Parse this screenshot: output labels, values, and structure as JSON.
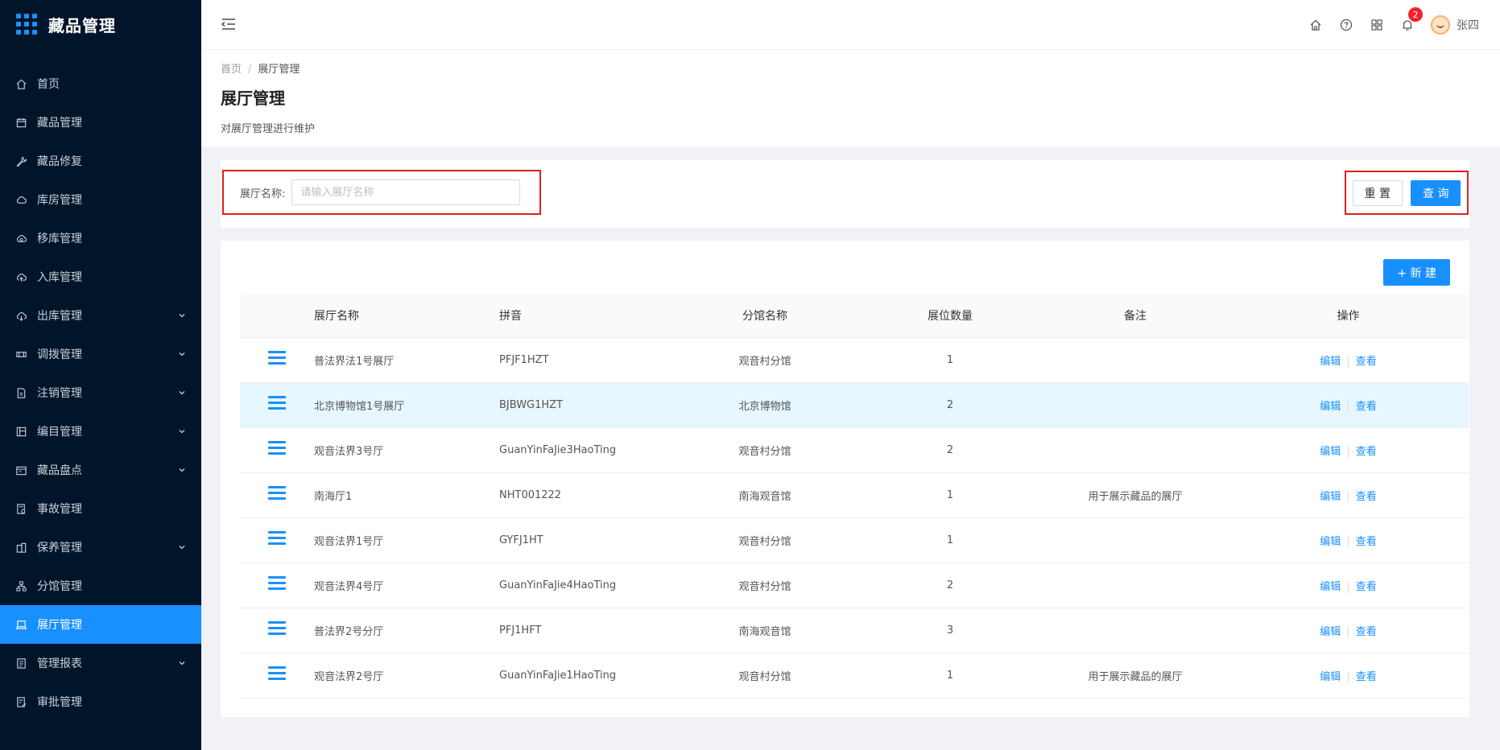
{
  "app": {
    "title": "藏品管理"
  },
  "sidebar": {
    "items": [
      {
        "label": "首页",
        "icon": "home-icon",
        "expandable": false,
        "active": false
      },
      {
        "label": "藏品管理",
        "icon": "calendar-icon",
        "expandable": false,
        "active": false
      },
      {
        "label": "藏品修复",
        "icon": "wrench-icon",
        "expandable": false,
        "active": false
      },
      {
        "label": "库房管理",
        "icon": "cloud-icon",
        "expandable": false,
        "active": false
      },
      {
        "label": "移库管理",
        "icon": "cloud-sync-icon",
        "expandable": false,
        "active": false
      },
      {
        "label": "入库管理",
        "icon": "cloud-upload-icon",
        "expandable": false,
        "active": false
      },
      {
        "label": "出库管理",
        "icon": "cloud-download-icon",
        "expandable": true,
        "active": false
      },
      {
        "label": "调拨管理",
        "icon": "transfer-icon",
        "expandable": true,
        "active": false
      },
      {
        "label": "注销管理",
        "icon": "file-icon",
        "expandable": true,
        "active": false
      },
      {
        "label": "编目管理",
        "icon": "catalog-icon",
        "expandable": true,
        "active": false
      },
      {
        "label": "藏品盘点",
        "icon": "inventory-icon",
        "expandable": true,
        "active": false
      },
      {
        "label": "事故管理",
        "icon": "report-icon",
        "expandable": false,
        "active": false
      },
      {
        "label": "保养管理",
        "icon": "building-icon",
        "expandable": true,
        "active": false
      },
      {
        "label": "分馆管理",
        "icon": "cluster-icon",
        "expandable": false,
        "active": false
      },
      {
        "label": "展厅管理",
        "icon": "laptop-icon",
        "expandable": false,
        "active": true
      },
      {
        "label": "管理报表",
        "icon": "chart-report-icon",
        "expandable": true,
        "active": false
      },
      {
        "label": "审批管理",
        "icon": "audit-icon",
        "expandable": false,
        "active": false
      }
    ]
  },
  "header": {
    "notification_count": "2",
    "user_name": "张四"
  },
  "breadcrumb": {
    "home": "首页",
    "separator": "/",
    "current": "展厅管理"
  },
  "page": {
    "title": "展厅管理",
    "description": "对展厅管理进行维护"
  },
  "search": {
    "label": "展厅名称:",
    "placeholder": "请输入展厅名称",
    "value": "",
    "reset_label": "重 置",
    "query_label": "查 询"
  },
  "table": {
    "new_label": "+ 新 建",
    "columns": [
      "展厅名称",
      "拼音",
      "分馆名称",
      "展位数量",
      "备注",
      "操作"
    ],
    "edit_label": "编辑",
    "view_label": "查看",
    "rows": [
      {
        "name": "普法界法1号展厅",
        "pinyin": "PFJF1HZT",
        "branch": "观音村分馆",
        "count": "1",
        "remark": ""
      },
      {
        "name": "北京博物馆1号展厅",
        "pinyin": "BJBWG1HZT",
        "branch": "北京博物馆",
        "count": "2",
        "remark": ""
      },
      {
        "name": "观音法界3号厅",
        "pinyin": "GuanYinFaJie3HaoTing",
        "branch": "观音村分馆",
        "count": "2",
        "remark": ""
      },
      {
        "name": "南海厅1",
        "pinyin": "NHT001222",
        "branch": "南海观音馆",
        "count": "1",
        "remark": "用于展示藏品的展厅"
      },
      {
        "name": "观音法界1号厅",
        "pinyin": "GYFJ1HT",
        "branch": "观音村分馆",
        "count": "1",
        "remark": ""
      },
      {
        "name": "观音法界4号厅",
        "pinyin": "GuanYinFaJie4HaoTing",
        "branch": "观音村分馆",
        "count": "2",
        "remark": ""
      },
      {
        "name": "普法界2号分厅",
        "pinyin": "PFJ1HFT",
        "branch": "南海观音馆",
        "count": "3",
        "remark": ""
      },
      {
        "name": "观音法界2号厅",
        "pinyin": "GuanYinFaJie1HaoTing",
        "branch": "观音村分馆",
        "count": "1",
        "remark": "用于展示藏品的展厅"
      }
    ],
    "highlighted_row": 1
  },
  "colors": {
    "primary": "#1890ff",
    "sidebar_bg": "#001529",
    "highlight_box": "#e02020",
    "row_highlight": "#e6f7ff"
  }
}
